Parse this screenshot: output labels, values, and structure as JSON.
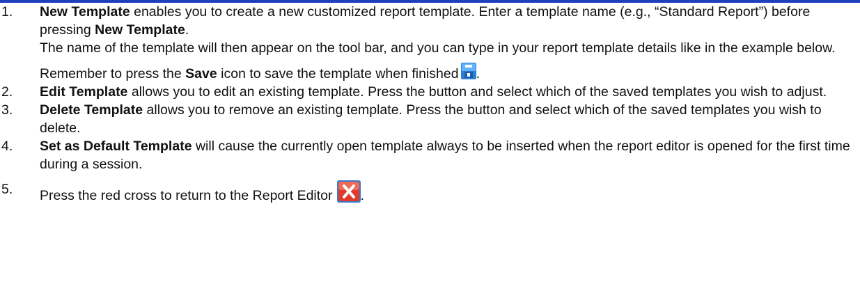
{
  "items": [
    {
      "number": "1.",
      "bold1": "New Template",
      "text1": " enables you to create a new customized report template. Enter a template name (e.g., “Standard Report”) before pressing ",
      "bold2": "New Template",
      "text2": ".",
      "para2": "The name of the template will then appear on the tool bar, and you can type in your report template details like in the example below.",
      "save_pre": "Remember to press the ",
      "save_bold": "Save",
      "save_post": " icon to save the template when finished",
      "save_end": ".",
      "icon": "save-icon"
    },
    {
      "number": "2.",
      "bold": "Edit Template",
      "text": " allows you to edit an existing template. Press the button and select which of the saved templates you wish to adjust."
    },
    {
      "number": "3.",
      "bold": "Delete Template",
      "text": " allows you to remove an existing template. Press the button and select which of the saved templates you wish to delete."
    },
    {
      "number": "4.",
      "bold": "Set as Default Template",
      "text": " will cause the currently open template always to be inserted when the report editor is opened for the first time during a session."
    },
    {
      "number": "5.",
      "text": "Press the red cross to return to the Report Editor",
      "text_end": ".",
      "icon": "close-icon",
      "icon_color": "#e03a2a"
    }
  ],
  "colors": {
    "top_rule": "#1f3fbf"
  }
}
